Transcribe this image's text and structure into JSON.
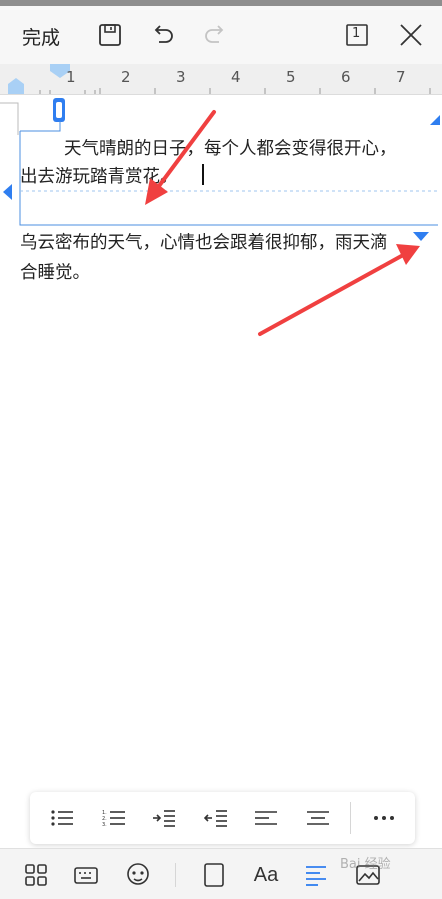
{
  "toolbar": {
    "done_label": "完成",
    "page_indicator": "1"
  },
  "ruler": {
    "numbers": [
      "1",
      "2",
      "3",
      "4",
      "5",
      "6",
      "7"
    ]
  },
  "document": {
    "paragraph1_line1": "天气晴朗的日子，每个人都会变得很开心，",
    "paragraph1_line2": "出去游玩踏青赏花。",
    "paragraph2_line1": "乌云密布的天气，心情也会跟着很抑郁，雨天滴",
    "paragraph2_line2": "合睡觉。"
  },
  "format_bar": {
    "icons": [
      "bullet-list-icon",
      "numbered-list-icon",
      "increase-indent-icon",
      "decrease-indent-icon",
      "align-left-icon",
      "align-center-icon",
      "more-icon"
    ]
  },
  "bottom_bar": {
    "icons": [
      "apps-grid-icon",
      "keyboard-icon",
      "emoji-icon",
      "page-frame-icon",
      "font-icon",
      "paragraph-icon",
      "image-icon"
    ],
    "font_label": "Aa",
    "active_color": "#2f7ef0"
  },
  "watermark": "Bai 经验"
}
